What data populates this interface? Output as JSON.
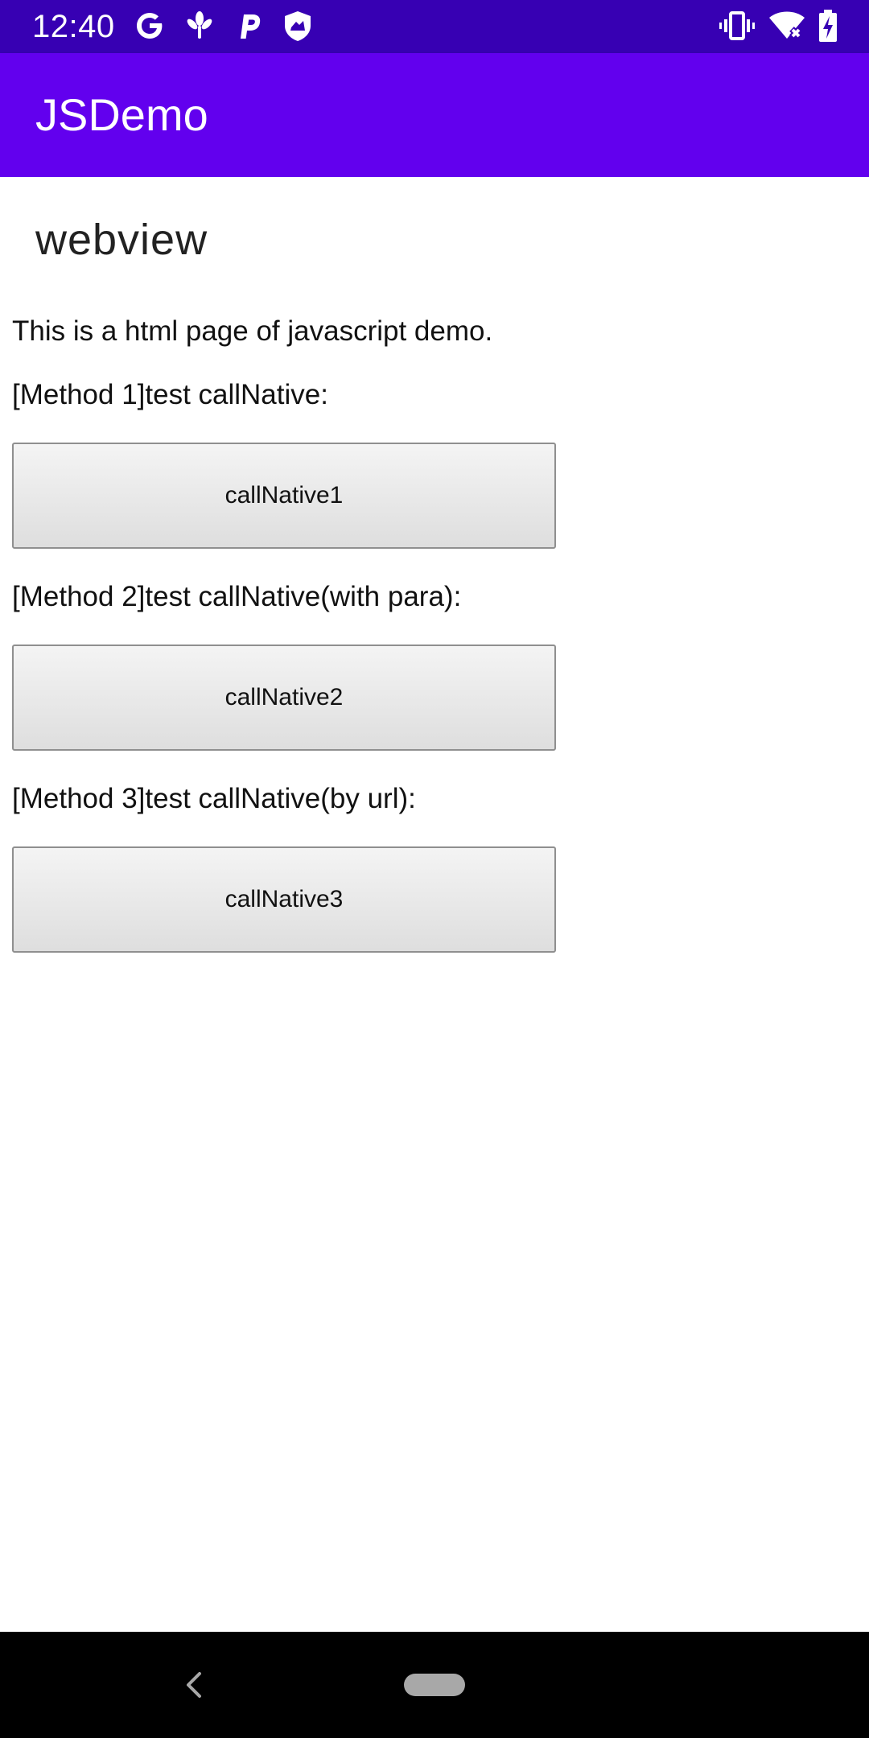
{
  "status_bar": {
    "time": "12:40",
    "left_icons": [
      "google-icon",
      "app-petal-icon",
      "parking-icon",
      "shield-icon"
    ],
    "right_icons": [
      "vibrate-icon",
      "wifi-off-icon",
      "battery-charging-icon"
    ],
    "background": "#3700b3"
  },
  "app_bar": {
    "title": "JSDemo",
    "background": "#6200ee"
  },
  "page": {
    "heading": "webview",
    "intro": "This is a html page of javascript demo.",
    "methods": [
      {
        "label": "[Method 1]test callNative:",
        "button": "callNative1"
      },
      {
        "label": "[Method 2]test callNative(with para):",
        "button": "callNative2"
      },
      {
        "label": "[Method 3]test callNative(by url):",
        "button": "callNative3"
      }
    ]
  },
  "nav_bar": {
    "icons": [
      "back-icon",
      "home-pill-icon"
    ]
  }
}
